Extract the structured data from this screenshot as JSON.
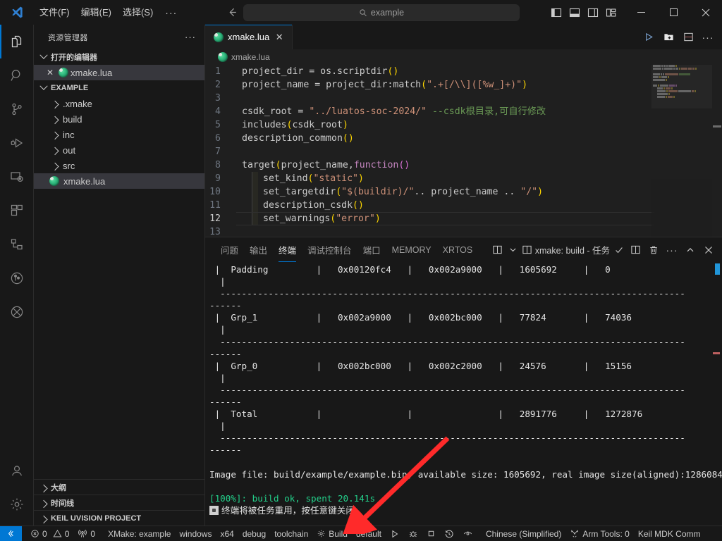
{
  "titlebar": {
    "menus": [
      "文件(F)",
      "编辑(E)",
      "选择(S)"
    ],
    "overflow": "···",
    "back_icon": "arrow-left-icon",
    "forward_icon": "arrow-right-icon",
    "command_center": {
      "icon": "search-icon",
      "value": "example"
    },
    "layout_buttons": [
      "toggle-primary-sidebar",
      "toggle-panel",
      "toggle-secondary-sidebar",
      "customize-layout"
    ],
    "window_controls": {
      "minimize": "—",
      "maximize": "☐",
      "close": "✕"
    }
  },
  "activitybar": {
    "items": [
      {
        "name": "explorer",
        "icon": "files-icon",
        "active": true
      },
      {
        "name": "search",
        "icon": "search-icon",
        "active": false
      },
      {
        "name": "source-control",
        "icon": "source-control-icon",
        "active": false
      },
      {
        "name": "run-and-debug",
        "icon": "debug-icon",
        "active": false
      },
      {
        "name": "remote-explorer",
        "icon": "remote-icon",
        "active": false
      },
      {
        "name": "extensions",
        "icon": "extensions-icon",
        "active": false
      },
      {
        "name": "project-manager",
        "icon": "project-tree-icon",
        "active": false
      },
      {
        "name": "gitlens",
        "icon": "gitlens-icon",
        "active": false
      },
      {
        "name": "embedded-tools",
        "icon": "circle-slash-icon",
        "active": false
      }
    ],
    "bottom": [
      {
        "name": "accounts",
        "icon": "account-icon"
      },
      {
        "name": "settings",
        "icon": "gear-icon"
      }
    ]
  },
  "sidebar": {
    "title": "资源管理器",
    "title_actions": "···",
    "open_editors": {
      "label": "打开的编辑器",
      "items": [
        {
          "label": "xmake.lua",
          "icon": "lua-file-icon",
          "close": "✕",
          "selected": true
        }
      ]
    },
    "workspace": {
      "label": "EXAMPLE",
      "items": [
        {
          "label": ".xmake",
          "type": "folder",
          "expanded": false
        },
        {
          "label": "build",
          "type": "folder",
          "expanded": false
        },
        {
          "label": "inc",
          "type": "folder",
          "expanded": false
        },
        {
          "label": "out",
          "type": "folder",
          "expanded": false
        },
        {
          "label": "src",
          "type": "folder",
          "expanded": false
        },
        {
          "label": "xmake.lua",
          "type": "lua-file",
          "selected": true
        }
      ]
    },
    "bottom_sections": [
      "大纲",
      "时间线",
      "KEIL UVISION PROJECT"
    ]
  },
  "editor": {
    "tab": {
      "label": "xmake.lua",
      "icon": "lua-file-icon",
      "close": "✕",
      "active": true
    },
    "actions": [
      "run-icon",
      "new-folder-icon",
      "split-editor-icon",
      "more-actions-icon"
    ],
    "breadcrumb": {
      "icon": "lua-file-icon",
      "label": "xmake.lua"
    },
    "lines": [
      {
        "n": "1",
        "tokens": [
          {
            "t": "project_dir ",
            "c": "plain"
          },
          {
            "t": "=",
            "c": "plain"
          },
          {
            "t": " os",
            "c": "plain"
          },
          {
            "t": ".",
            "c": "plain"
          },
          {
            "t": "scriptdir",
            "c": "plain"
          },
          {
            "t": "()",
            "c": "par1"
          }
        ]
      },
      {
        "n": "2",
        "tokens": [
          {
            "t": "project_name ",
            "c": "plain"
          },
          {
            "t": "=",
            "c": "plain"
          },
          {
            "t": " project_dir",
            "c": "plain"
          },
          {
            "t": ":",
            "c": "plain"
          },
          {
            "t": "match",
            "c": "plain"
          },
          {
            "t": "(",
            "c": "par1"
          },
          {
            "t": "\".+[/\\\\](",
            "c": "str"
          },
          {
            "t": "[%w_]",
            "c": "str"
          },
          {
            "t": "+)\"",
            "c": "str"
          },
          {
            "t": ")",
            "c": "par1"
          }
        ]
      },
      {
        "n": "3",
        "tokens": []
      },
      {
        "n": "4",
        "tokens": [
          {
            "t": "csdk_root ",
            "c": "plain"
          },
          {
            "t": "=",
            "c": "plain"
          },
          {
            "t": " ",
            "c": "plain"
          },
          {
            "t": "\"../luatos-soc-2024/\"",
            "c": "str"
          },
          {
            "t": " --csdk根目录,可自行修改",
            "c": "com"
          }
        ]
      },
      {
        "n": "5",
        "tokens": [
          {
            "t": "includes",
            "c": "plain"
          },
          {
            "t": "(",
            "c": "par1"
          },
          {
            "t": "csdk_root",
            "c": "plain"
          },
          {
            "t": ")",
            "c": "par1"
          }
        ]
      },
      {
        "n": "6",
        "tokens": [
          {
            "t": "description_common",
            "c": "plain"
          },
          {
            "t": "()",
            "c": "par1"
          }
        ]
      },
      {
        "n": "7",
        "tokens": []
      },
      {
        "n": "8",
        "tokens": [
          {
            "t": "target",
            "c": "plain"
          },
          {
            "t": "(",
            "c": "par1"
          },
          {
            "t": "project_name,",
            "c": "plain"
          },
          {
            "t": "function",
            "c": "kw"
          },
          {
            "t": "()",
            "c": "par2"
          }
        ]
      },
      {
        "n": "9",
        "indent": true,
        "tokens": [
          {
            "t": "set_kind",
            "c": "plain"
          },
          {
            "t": "(",
            "c": "par1"
          },
          {
            "t": "\"static\"",
            "c": "str"
          },
          {
            "t": ")",
            "c": "par1"
          }
        ]
      },
      {
        "n": "10",
        "indent": true,
        "tokens": [
          {
            "t": "set_targetdir",
            "c": "plain"
          },
          {
            "t": "(",
            "c": "par1"
          },
          {
            "t": "\"$(buildir)/\"",
            "c": "str"
          },
          {
            "t": ".. project_name .. ",
            "c": "plain"
          },
          {
            "t": "\"/\"",
            "c": "str"
          },
          {
            "t": ")",
            "c": "par1"
          }
        ]
      },
      {
        "n": "11",
        "indent": true,
        "tokens": [
          {
            "t": "description_csdk",
            "c": "plain"
          },
          {
            "t": "()",
            "c": "par1"
          }
        ]
      },
      {
        "n": "12",
        "indent": true,
        "current": true,
        "tokens": [
          {
            "t": "set_warnings",
            "c": "plain"
          },
          {
            "t": "(",
            "c": "par1"
          },
          {
            "t": "\"error\"",
            "c": "str"
          },
          {
            "t": ")",
            "c": "par1"
          }
        ]
      },
      {
        "n": "13",
        "tokens": []
      }
    ]
  },
  "panel": {
    "tabs": [
      {
        "label": "问题",
        "active": false
      },
      {
        "label": "输出",
        "active": false
      },
      {
        "label": "终端",
        "active": true
      },
      {
        "label": "调试控制台",
        "active": false
      },
      {
        "label": "端口",
        "active": false
      },
      {
        "label": "MEMORY",
        "active": false
      },
      {
        "label": "XRTOS",
        "active": false
      }
    ],
    "actions": {
      "split_icon": "split-terminal-icon",
      "dropdown_icon": "chevron-down-icon",
      "terminal_icon": "terminal-icon",
      "terminal_name": "xmake: build - 任务",
      "check_icon": "check-icon",
      "layout_icon": "split-panel-icon",
      "kill_icon": "trash-icon",
      "more_icon": "more-actions-icon",
      "maximize_icon": "chevron-up-icon",
      "close_icon": "close-icon"
    },
    "terminal_lines": [
      {
        "text": " |  Padding         |   0x00120fc4   |   0x002a9000   |   1605692     |   0",
        "cls": "t-white"
      },
      {
        "text": "  |",
        "cls": "t-white"
      },
      {
        "text": "  ---------------------------------------------------------------------------------------",
        "cls": "t-white"
      },
      {
        "text": "------",
        "cls": "t-white"
      },
      {
        "text": " |  Grp_1           |   0x002a9000   |   0x002bc000   |   77824       |   74036",
        "cls": "t-white"
      },
      {
        "text": "  |",
        "cls": "t-white"
      },
      {
        "text": "  ---------------------------------------------------------------------------------------",
        "cls": "t-white"
      },
      {
        "text": "------",
        "cls": "t-white"
      },
      {
        "text": " |  Grp_0           |   0x002bc000   |   0x002c2000   |   24576       |   15156",
        "cls": "t-white"
      },
      {
        "text": "  |",
        "cls": "t-white"
      },
      {
        "text": "  ---------------------------------------------------------------------------------------",
        "cls": "t-white"
      },
      {
        "text": "------",
        "cls": "t-white"
      },
      {
        "text": " |  Total           |                |                |   2891776     |   1272876",
        "cls": "t-white"
      },
      {
        "text": "  |",
        "cls": "t-white"
      },
      {
        "text": "  ---------------------------------------------------------------------------------------",
        "cls": "t-white"
      },
      {
        "text": "------",
        "cls": "t-white"
      },
      {
        "text": "",
        "cls": "t-white"
      },
      {
        "text": "Image file: build/example/example.bin, available size: 1605692, real image size(aligned):1286084",
        "cls": "t-white"
      },
      {
        "text": "",
        "cls": "t-white"
      }
    ],
    "build_ok": "[100%]: build ok, spent 20.141s",
    "reuse_notice": "终端将被任务重用，按任意键关闭。"
  },
  "statusbar": {
    "remote_icon": "remote-indicator-icon",
    "left_items": [
      {
        "icon": "error-icon",
        "label": "0",
        "second_icon": "warning-icon",
        "second_label": "0"
      },
      {
        "icon": "radio-tower-icon",
        "label": "0"
      },
      {
        "label": "XMake: example"
      },
      {
        "label": "windows"
      },
      {
        "label": "x64"
      },
      {
        "label": "debug"
      },
      {
        "label": "toolchain"
      },
      {
        "icon": "gear-icon",
        "label": "Build"
      },
      {
        "label": "default"
      },
      {
        "icon": "play-icon",
        "label": ""
      },
      {
        "icon": "debug-alt-icon",
        "label": ""
      },
      {
        "icon": "stop-square-icon",
        "label": ""
      },
      {
        "icon": "history-icon",
        "label": ""
      },
      {
        "icon": "eye-icon",
        "label": ""
      },
      {
        "label": "Chinese (Simplified)"
      },
      {
        "icon": "tools-icon",
        "label": "Arm Tools: 0"
      },
      {
        "label": "Keil MDK Comm"
      }
    ]
  },
  "annotation": {
    "arrow_color": "#ff2a2a",
    "description": "red arrow pointing from terminal toward status bar Build button"
  }
}
